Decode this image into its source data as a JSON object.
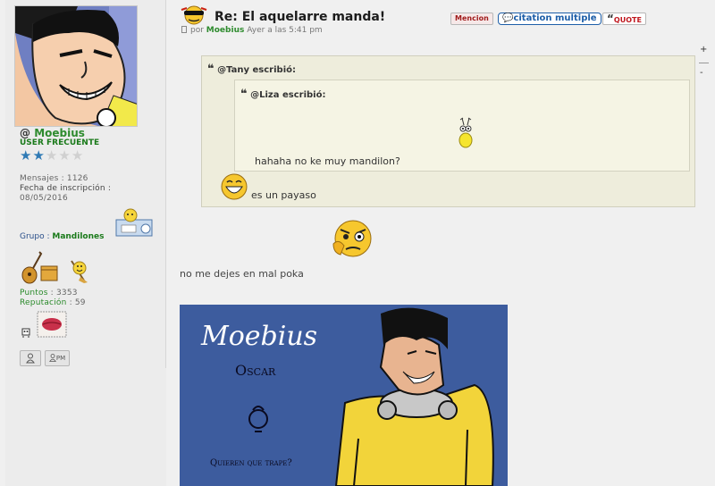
{
  "user": {
    "at_sign": "@",
    "name": "Moebius",
    "rank": "USER FRECUENTE",
    "stars_filled": 2,
    "stars_total": 5,
    "messages_label": "Mensajes",
    "messages_value": "1126",
    "joined_label": "Fecha de inscripción",
    "joined_value": "08/05/2016",
    "group_label": "Grupo",
    "group_value": "Mandilones",
    "points_label": "Puntos",
    "points_value": "3353",
    "reputation_label": "Reputación",
    "reputation_value": "59",
    "separator": " : ",
    "profile_button": "",
    "pm_button": "PM"
  },
  "post": {
    "title": "Re: El aquelarre manda!",
    "by": "por",
    "author": "Moebius",
    "time": "Ayer a las 5:41 pm",
    "buttons": {
      "mencion": "Mencion",
      "citation": "citation multiple",
      "quote": "QUOTE"
    },
    "side_plus": "+",
    "side_minus": "-",
    "outer_quote": {
      "header": "@Tany escribió:",
      "text": "es un payaso"
    },
    "inner_quote": {
      "header": "@Liza escribió:",
      "text": "hahaha no ke muy mandilon?"
    },
    "body_text": "no me dejes en mal poka",
    "banner": {
      "title": "Moebius",
      "subtitle": "Oscar",
      "caption": "Quieren que trape?"
    }
  },
  "colors": {
    "author_green": "#2e8b2e",
    "quote_bg": "#eeeddc",
    "banner_blue": "#3a5a9c",
    "citation_blue": "#1d5ea8",
    "quote_red": "#c0181f"
  }
}
